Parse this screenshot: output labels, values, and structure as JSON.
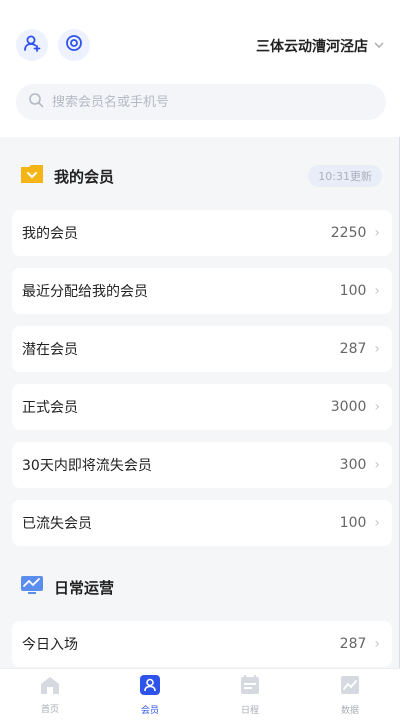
{
  "header": {
    "store_name": "三体云动漕河泾店",
    "icons": [
      "user-add-icon",
      "settings-icon",
      "chevron-down-icon"
    ]
  },
  "search": {
    "placeholder": "搜索会员名或手机号"
  },
  "my_members": {
    "title": "我的会员",
    "updated": "10:31更新",
    "rows": [
      {
        "label": "我的会员",
        "count": "2250"
      },
      {
        "label": "最近分配给我的会员",
        "count": "100"
      },
      {
        "label": "潜在会员",
        "count": "287"
      },
      {
        "label": "正式会员",
        "count": "3000"
      },
      {
        "label": "30天内即将流失会员",
        "count": "300"
      },
      {
        "label": "已流失会员",
        "count": "100"
      }
    ]
  },
  "daily_ops": {
    "title": "日常运营",
    "rows": [
      {
        "label": "今日入场",
        "count": "287"
      }
    ]
  },
  "tabbar": {
    "tabs": [
      {
        "label": "首页"
      },
      {
        "label": "会员"
      },
      {
        "label": "日程"
      },
      {
        "label": "数据"
      }
    ],
    "active_color": "#2f54eb"
  },
  "colors": {
    "accent": "#2f54eb",
    "folder": "#f5b516",
    "background": "#f5f6f8"
  }
}
